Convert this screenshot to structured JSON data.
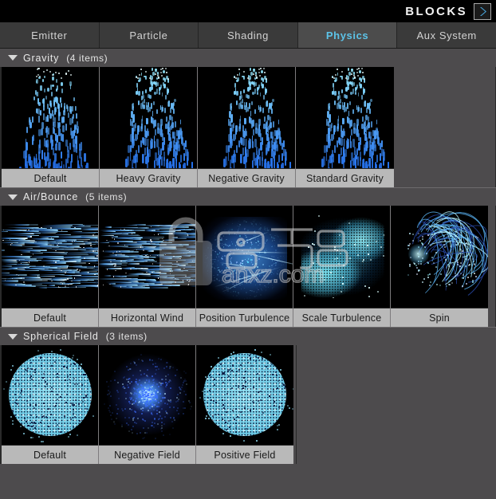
{
  "header": {
    "title": "BLOCKS",
    "arrow_icon": "chevron-right-icon",
    "arrow_color": "#4aa8e0"
  },
  "tabs": [
    {
      "label": "Emitter",
      "active": false
    },
    {
      "label": "Particle",
      "active": false
    },
    {
      "label": "Shading",
      "active": false
    },
    {
      "label": "Physics",
      "active": true
    },
    {
      "label": "Aux System",
      "active": false
    }
  ],
  "accent_color": "#5cc3e8",
  "background_color": "#4d4b4d",
  "label_background_color": "#b9b9b9",
  "sections": [
    {
      "title": "Gravity",
      "count": "(4 items)",
      "disclosure_icon": "triangle-down-icon",
      "items": [
        {
          "label": "Default"
        },
        {
          "label": "Heavy Gravity"
        },
        {
          "label": "Negative Gravity"
        },
        {
          "label": "Standard Gravity"
        }
      ]
    },
    {
      "title": "Air/Bounce",
      "count": "(5 items)",
      "disclosure_icon": "triangle-down-icon",
      "items": [
        {
          "label": "Default"
        },
        {
          "label": "Horizontal Wind"
        },
        {
          "label": "Position Turbulence"
        },
        {
          "label": "Scale Turbulence"
        },
        {
          "label": "Spin"
        }
      ]
    },
    {
      "title": "Spherical Field",
      "count": "(3 items)",
      "disclosure_icon": "triangle-down-icon",
      "items": [
        {
          "label": "Default"
        },
        {
          "label": "Negative Field"
        },
        {
          "label": "Positive Field"
        }
      ]
    }
  ],
  "watermark": {
    "cn_text": "安下",
    "site_text": "anxz.com",
    "lock_icon": "lock-icon"
  }
}
